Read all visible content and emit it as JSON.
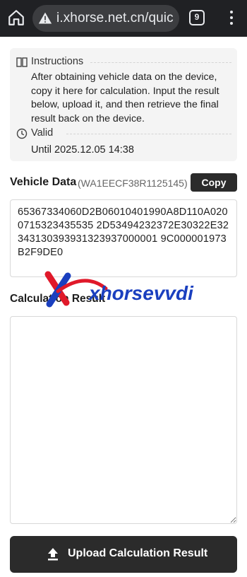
{
  "browser": {
    "url": "i.xhorse.net.cn/quic",
    "tab_count": "9",
    "icons": {
      "home": "home-icon",
      "security": "warning-icon",
      "tabs": "tab-switcher-icon",
      "menu": "more-vert-icon"
    }
  },
  "info": {
    "instructions_label": "Instructions",
    "instructions_text": "After obtaining vehicle data on the device, copy it here for calculation. Input the result below, upload it, and then retrieve the final result back on the device.",
    "valid_label": "Valid",
    "valid_text": "Until 2025.12.05 14:38",
    "icons": {
      "instructions": "book-icon",
      "valid": "clock-icon"
    }
  },
  "vehicle": {
    "title": "Vehicle Data",
    "vin": "(WA1EECF38R1125145)",
    "copy_label": "Copy",
    "data": "65367334060D2B06010401990A8D110A0200715323435535 2D53494232372E30322E32343130393931323937000001 9C000001973B2F9DE0"
  },
  "calculation": {
    "title": "Calculation Result",
    "value": ""
  },
  "watermark": {
    "text": "xhorsevvdi"
  },
  "upload": {
    "label": "Upload Calculation Result",
    "icon": "upload-icon"
  },
  "colors": {
    "topbar": "#202124",
    "button": "#2b2b2b",
    "card": "#f4f4f4",
    "watermark_blue": "#1a3fbf",
    "watermark_red": "#e0192a"
  }
}
